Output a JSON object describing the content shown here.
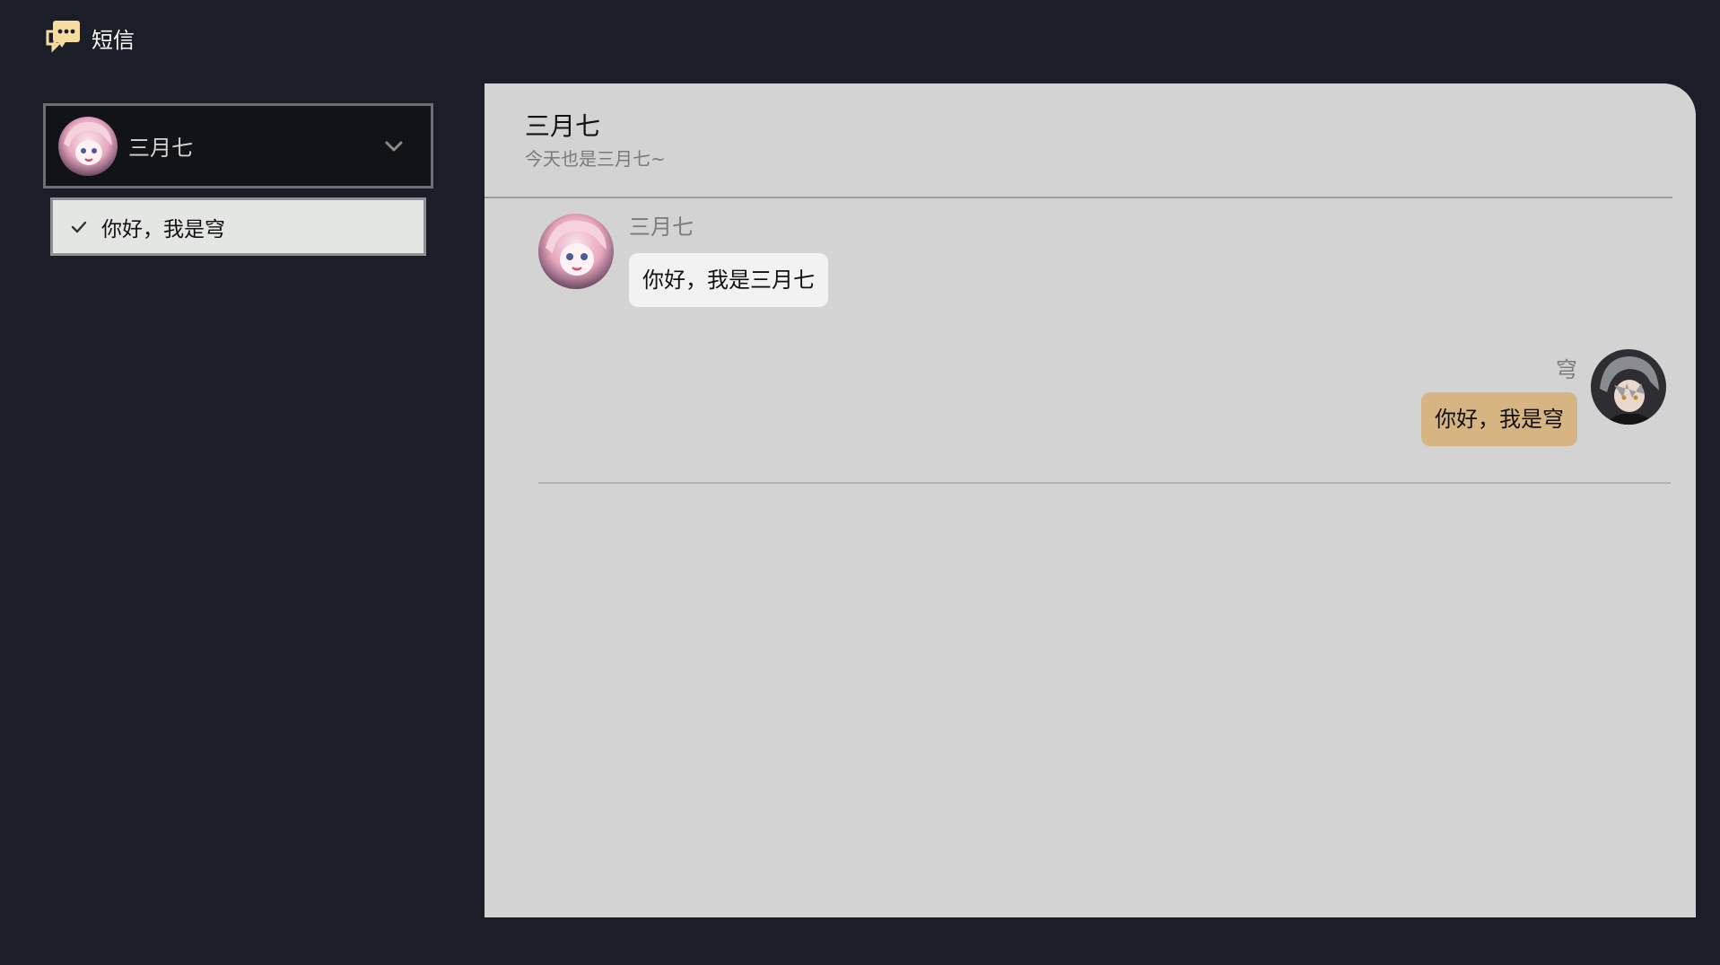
{
  "app": {
    "title": "短信",
    "icon": "chat-bubble-icon",
    "accent_color": "#f7dca0"
  },
  "contact_selector": {
    "selected_contact": "三月七",
    "avatar": "march7-avatar",
    "chevron": "chevron-down-icon"
  },
  "reply_options": [
    {
      "text": "你好，我是穹",
      "selected": true
    }
  ],
  "chat": {
    "title": "三月七",
    "subtitle": "今天也是三月七~",
    "messages": [
      {
        "sender": "三月七",
        "text": "你好，我是三月七",
        "direction": "incoming",
        "bubble_color": "#f2f2f2"
      },
      {
        "sender": "穹",
        "text": "你好，我是穹",
        "direction": "outgoing",
        "bubble_color": "#d6b582"
      }
    ]
  }
}
